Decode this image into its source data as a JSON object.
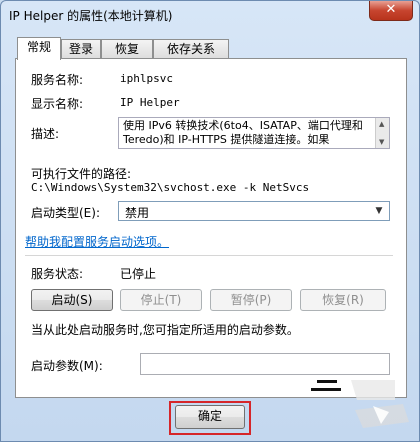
{
  "window": {
    "title": "IP Helper 的属性(本地计算机)",
    "close_label": "✕"
  },
  "tabs": [
    {
      "label": "常规",
      "active": true
    },
    {
      "label": "登录",
      "active": false
    },
    {
      "label": "恢复",
      "active": false
    },
    {
      "label": "依存关系",
      "active": false
    }
  ],
  "general": {
    "service_name_label": "服务名称:",
    "service_name_value": "iphlpsvc",
    "display_name_label": "显示名称:",
    "display_name_value": "IP Helper",
    "description_label": "描述:",
    "description_value": "使用 IPv6 转换技术(6to4、ISATAP、端口代理和 Teredo)和 IP-HTTPS 提供隧道连接。如果",
    "exe_path_label": "可执行文件的路径:",
    "exe_path_value": "C:\\Windows\\System32\\svchost.exe -k NetSvcs",
    "startup_type_label": "启动类型(E):",
    "startup_type_value": "禁用",
    "help_link": "帮助我配置服务启动选项。",
    "service_status_label": "服务状态:",
    "service_status_value": "已停止",
    "buttons": {
      "start": "启动(S)",
      "stop": "停止(T)",
      "pause": "暂停(P)",
      "resume": "恢复(R)"
    },
    "start_hint": "当从此处启动服务时,您可指定所适用的启动参数。",
    "start_params_label": "启动参数(M):",
    "start_params_value": ""
  },
  "footer": {
    "ok_label": "确定"
  },
  "colors": {
    "highlight": "#d6262a",
    "link": "#0066cc"
  }
}
